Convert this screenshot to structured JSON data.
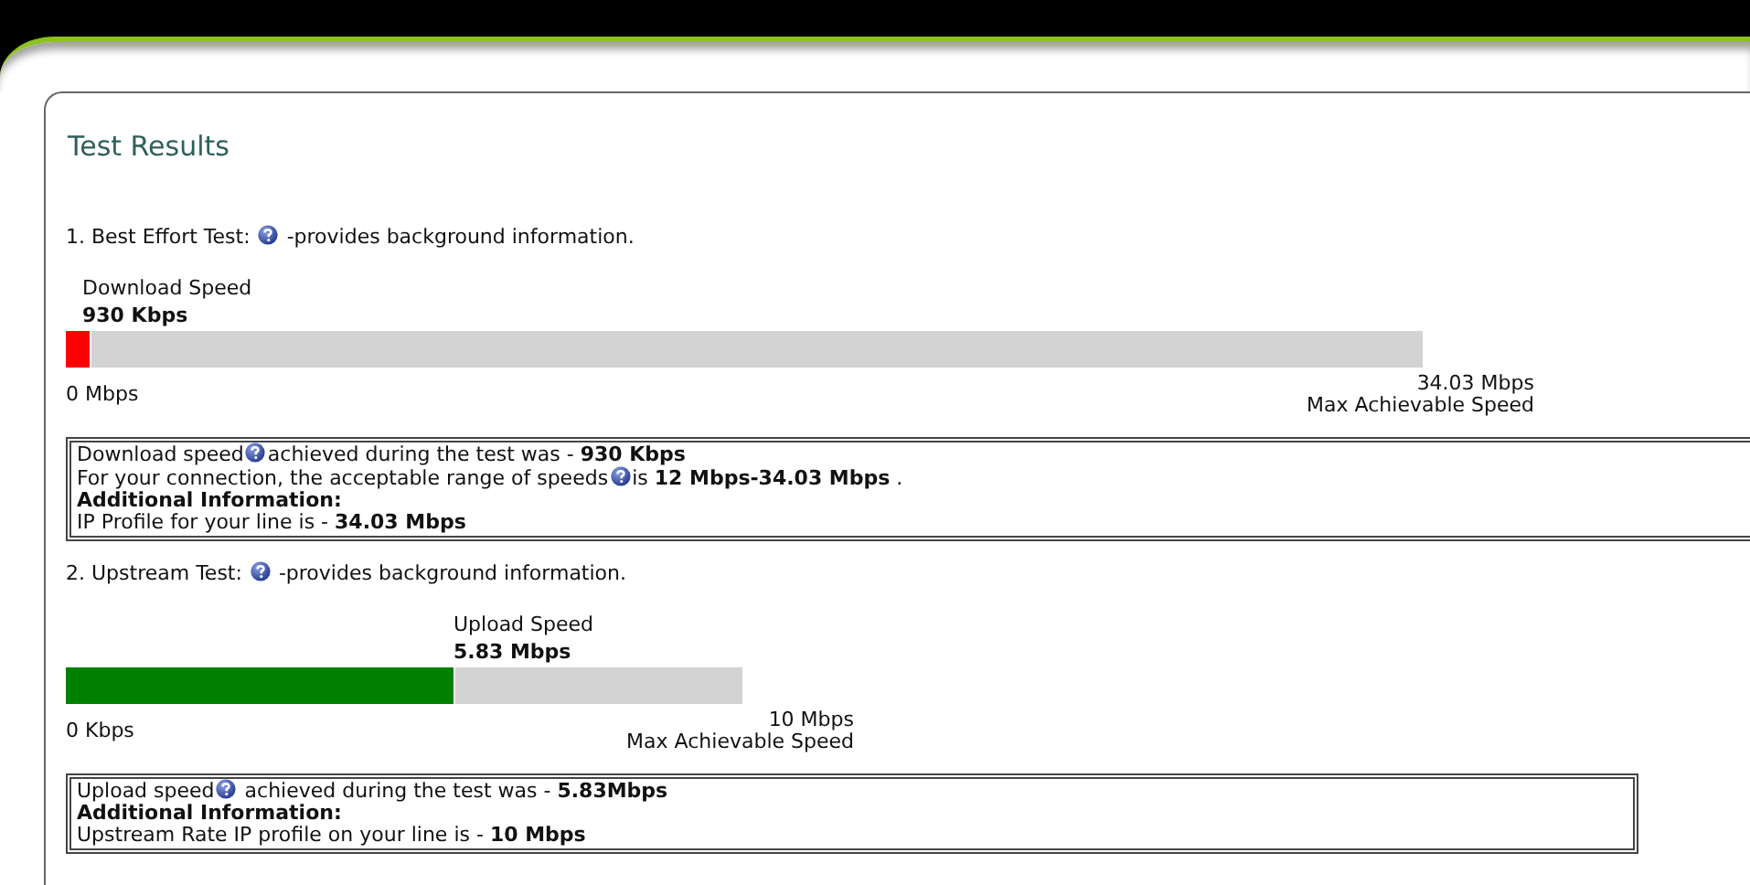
{
  "title": "Test Results",
  "tests": [
    {
      "kind": "download",
      "heading": "1. Best Effort Test:",
      "heading_note": "-provides background information.",
      "speed_label": "Download Speed",
      "speed_value": "930 Kbps",
      "level": 0.019,
      "color": "#ff0000",
      "min_label": "0 Mbps",
      "max_value": "34.03 Mbps",
      "max_label": "Max Achievable Speed",
      "info": [
        {
          "kind": "text",
          "parts": [
            "Download speed",
            "achieved during the test was - **930 Kbps**"
          ]
        },
        {
          "kind": "text",
          "parts": [
            "For your connection, the acceptable range of speeds",
            "is **12 Mbps-34.03 Mbps** ."
          ]
        },
        {
          "kind": "heading",
          "parts": [
            "Additional Information:"
          ]
        },
        {
          "kind": "text",
          "parts": [
            "IP Profile for your line is - **34.03 Mbps**"
          ]
        }
      ]
    },
    {
      "kind": "upload",
      "heading": "2. Upstream Test:",
      "heading_note": "-provides background information.",
      "speed_label": "Upload Speed",
      "speed_value": "5.83 Mbps",
      "level": 0.576,
      "color": "#008000",
      "min_label": "0 Kbps",
      "max_value": "10 Mbps",
      "max_label": "Max Achievable Speed",
      "info": [
        {
          "kind": "text",
          "parts": [
            "Upload speed",
            " achieved during the test was - **5.83Mbps**"
          ]
        },
        {
          "kind": "heading",
          "parts": [
            "Additional Information:"
          ]
        },
        {
          "kind": "text",
          "parts": [
            "Upstream Rate IP profile on your line is - **10 Mbps**"
          ]
        }
      ]
    }
  ]
}
